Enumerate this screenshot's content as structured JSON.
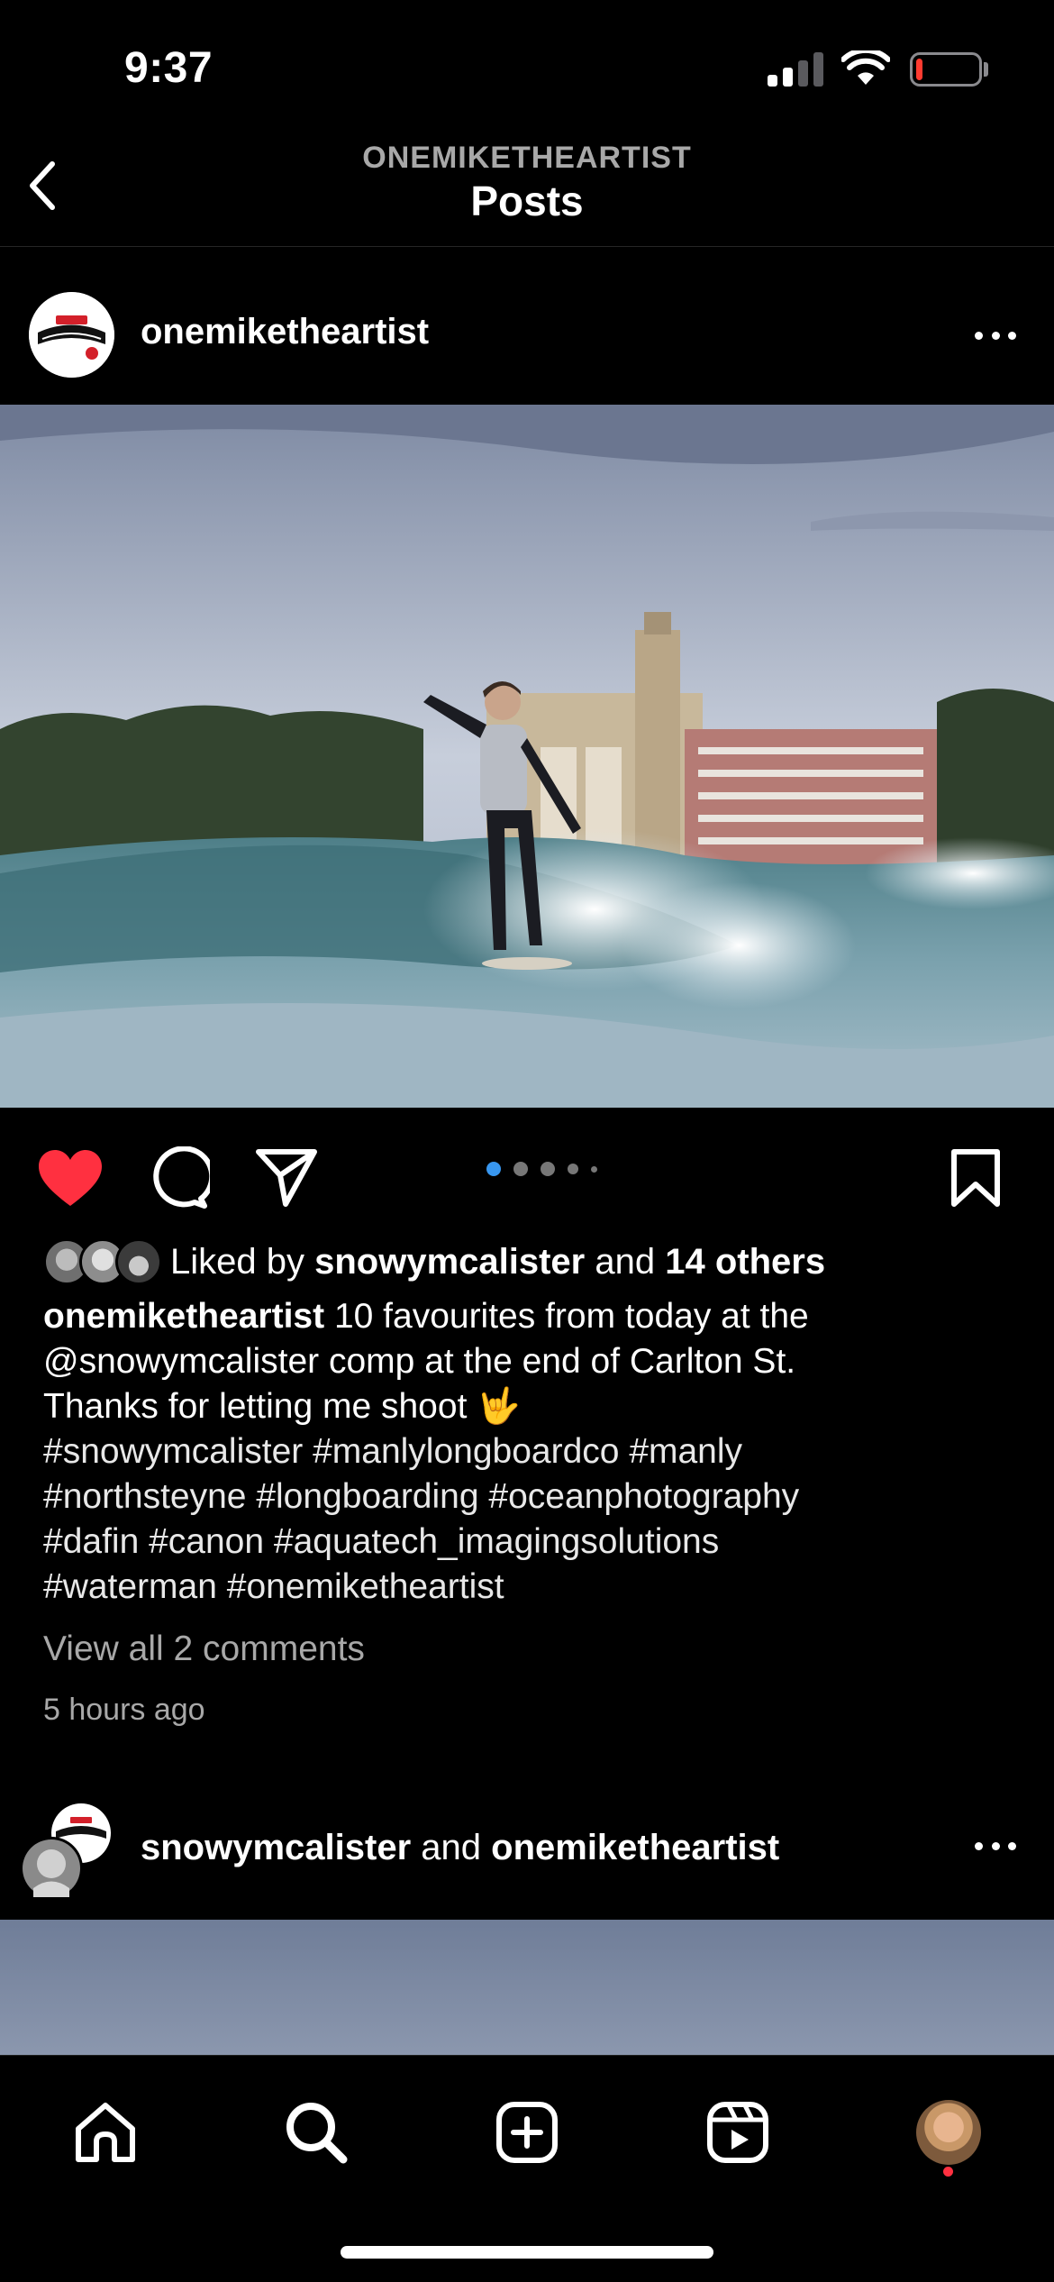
{
  "status_bar": {
    "time": "9:37",
    "signal_icon": "cellular-signal-icon",
    "wifi_icon": "wifi-icon",
    "battery_icon": "battery-low-icon",
    "battery_level": 0.1
  },
  "header": {
    "back_icon": "chevron-left-icon",
    "account": "ONEMIKETHEARTIST",
    "title": "Posts"
  },
  "post": {
    "username": "onemiketheartist",
    "more_icon": "more-horizontal-icon",
    "actions": {
      "like_icon": "heart-filled-icon",
      "comment_icon": "comment-icon",
      "share_icon": "send-icon",
      "save_icon": "bookmark-icon"
    },
    "carousel": {
      "total_dots": 5,
      "active_index": 0
    },
    "likes": {
      "prefix": "Liked by",
      "user": "snowymcalister",
      "conjunction": "and",
      "others": "14 others"
    },
    "caption": {
      "author": "onemiketheartist",
      "line1": "10 favourites from today at the",
      "line2": "@snowymcalister comp at the end of Carlton St.",
      "line3": "Thanks for letting me shoot 🤟",
      "hashtags": [
        "#snowymcalister #manlylongboardco #manly",
        "#northsteyne #longboarding #oceanphotography",
        "#dafin #canon #aquatech_imagingsolutions",
        "#waterman #onemiketheartist"
      ]
    },
    "view_comments": "View all 2 comments",
    "timestamp": "5 hours ago"
  },
  "post2": {
    "user1": "snowymcalister",
    "conjunction": "and",
    "user2": "onemiketheartist",
    "more_icon": "more-horizontal-icon"
  },
  "tab_bar": {
    "home_icon": "home-icon",
    "search_icon": "search-icon",
    "create_icon": "plus-square-icon",
    "reels_icon": "reels-icon",
    "profile_icon": "profile-avatar"
  },
  "colors": {
    "like_red": "#ff3040",
    "carousel_active": "#3897f0",
    "secondary_text": "#a8a8a8"
  }
}
